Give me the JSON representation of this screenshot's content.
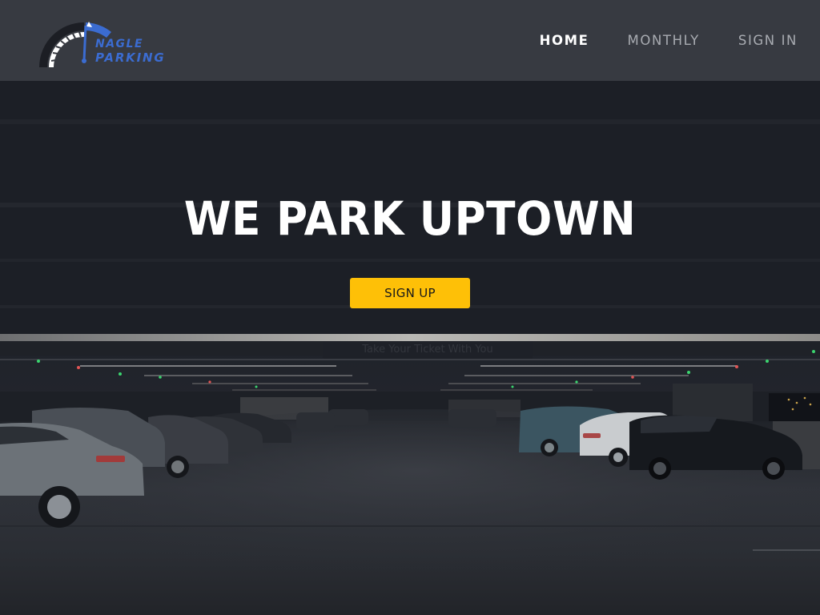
{
  "brand": {
    "line1": "NAGLE",
    "line2": "PARKING",
    "logo_icon": "speedometer-gauge-icon",
    "accent_color": "#3b6cd1"
  },
  "nav": {
    "items": [
      {
        "label": "HOME",
        "active": true
      },
      {
        "label": "MONTHLY",
        "active": false
      },
      {
        "label": "SIGN IN",
        "active": false
      }
    ]
  },
  "hero": {
    "title": "WE PARK UPTOWN",
    "cta_label": "SIGN UP",
    "cta_color": "#fec007",
    "background_sign": "Take Your Ticket With You"
  },
  "colors": {
    "header_bg": "#373a41",
    "hero_bg": "#1c1f26"
  }
}
